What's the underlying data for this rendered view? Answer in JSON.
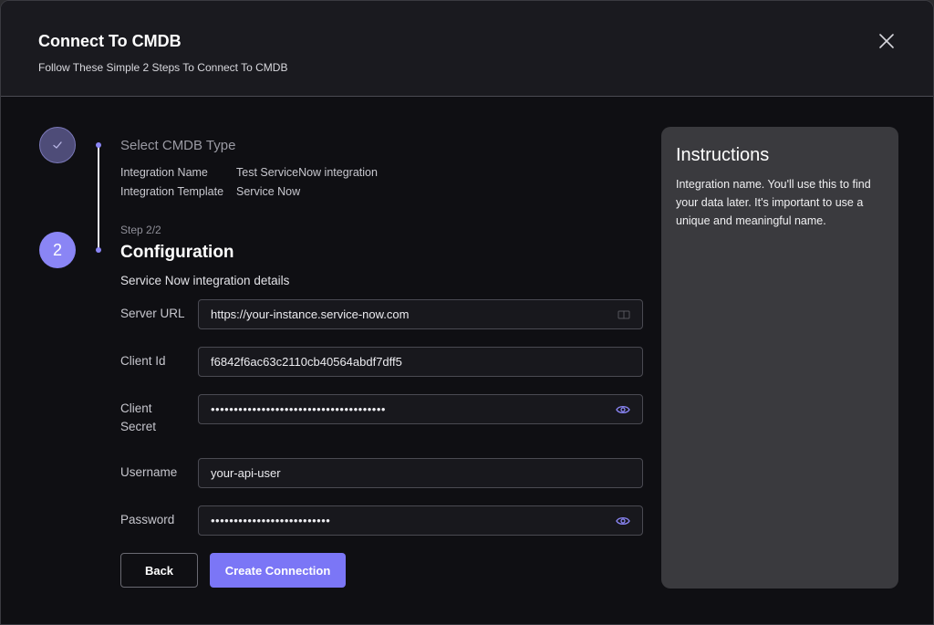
{
  "header": {
    "title": "Connect To CMDB",
    "subtitle": "Follow These Simple 2 Steps To Connect To CMDB",
    "close_icon": "close-icon"
  },
  "step1": {
    "icon": "check-icon",
    "title": "Select CMDB Type",
    "fields": [
      {
        "key": "Integration Name",
        "value": "Test ServiceNow integration"
      },
      {
        "key": "Integration Template",
        "value": "Service Now"
      }
    ]
  },
  "step2": {
    "number": "2",
    "count": "Step 2/2",
    "title": "Configuration",
    "description": "Service Now integration details"
  },
  "form": {
    "server_url": {
      "label": "Server URL",
      "value": "https://your-instance.service-now.com"
    },
    "client_id": {
      "label": "Client Id",
      "value": "f6842f6ac63c2110cb40564abdf7dff5"
    },
    "client_secret": {
      "label_line1": "Client",
      "label_line2": "Secret",
      "masked_value": "••••••••••••••••••••••••••••••••••••••"
    },
    "username": {
      "label": "Username",
      "value": "your-api-user"
    },
    "password": {
      "label": "Password",
      "masked_value": "••••••••••••••••••••••••••"
    }
  },
  "buttons": {
    "back": "Back",
    "create": "Create Connection"
  },
  "instructions": {
    "title": "Instructions",
    "text": "Integration name. You'll use this to find your data later. It's important to use a unique and meaningful name."
  },
  "colors": {
    "accent": "#7b76f6",
    "background": "#0f0f13",
    "panel": "#3a3a3e"
  }
}
